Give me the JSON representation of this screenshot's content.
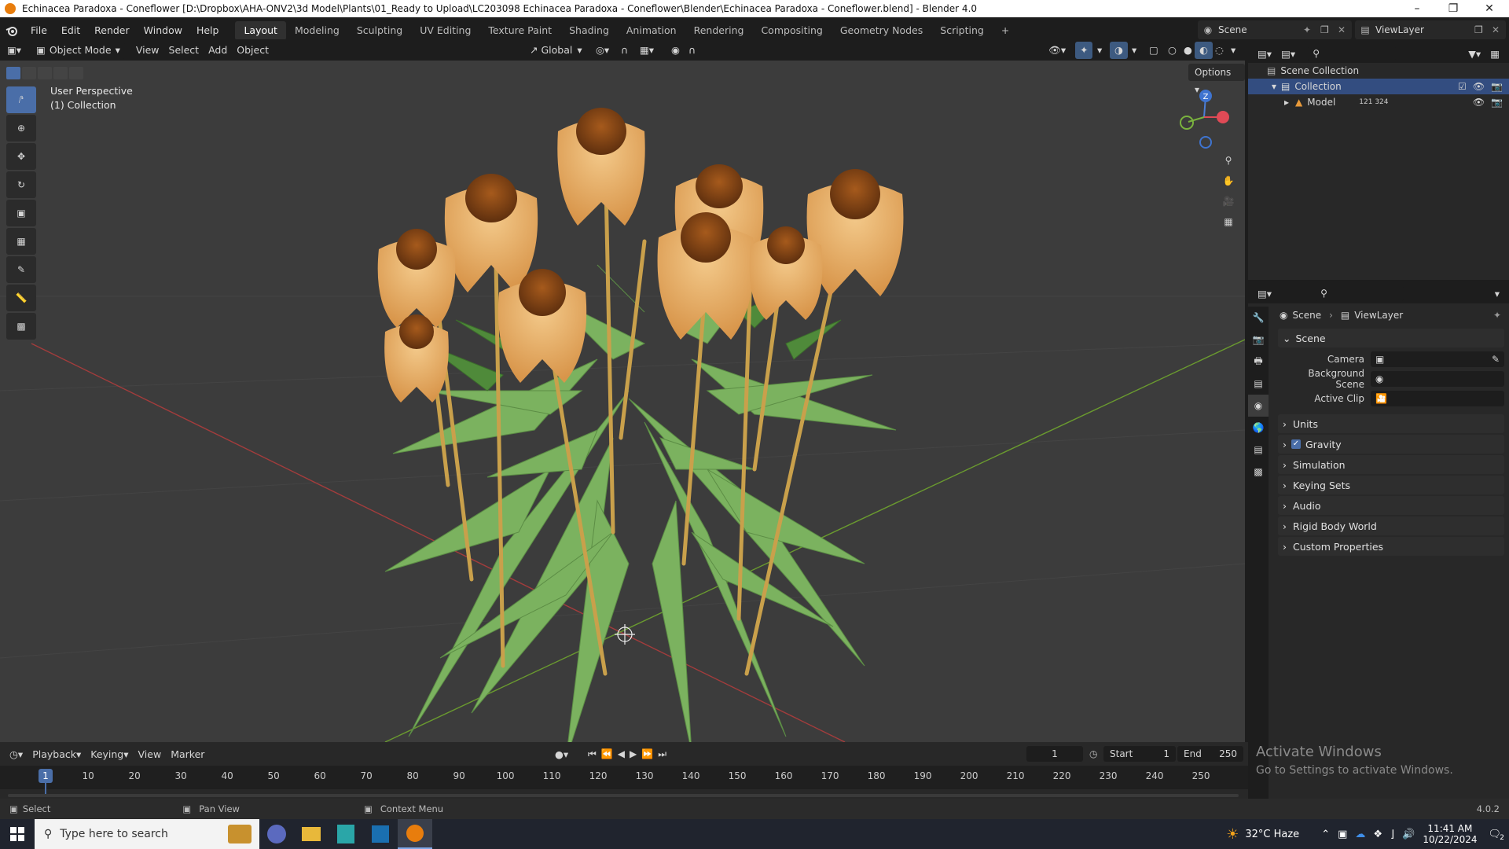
{
  "window": {
    "title": "Echinacea Paradoxa - Coneflower [D:\\Dropbox\\AHA-ONV2\\3d Model\\Plants\\01_Ready to Upload\\LC203098 Echinacea Paradoxa - Coneflower\\Blender\\Echinacea Paradoxa - Coneflower.blend] - Blender 4.0"
  },
  "menu": {
    "items": [
      "File",
      "Edit",
      "Render",
      "Window",
      "Help"
    ]
  },
  "workspaces": {
    "tabs": [
      "Layout",
      "Modeling",
      "Sculpting",
      "UV Editing",
      "Texture Paint",
      "Shading",
      "Animation",
      "Rendering",
      "Compositing",
      "Geometry Nodes",
      "Scripting"
    ],
    "active": "Layout"
  },
  "topright": {
    "scene_label": "Scene",
    "viewlayer_label": "ViewLayer"
  },
  "viewport_header": {
    "mode": "Object Mode",
    "menus": [
      "View",
      "Select",
      "Add",
      "Object"
    ],
    "orientation": "Global",
    "options": "Options"
  },
  "viewport": {
    "perspective": "User Perspective",
    "collection": "(1) Collection",
    "gizmo_z": "Z"
  },
  "outliner": {
    "root": "Scene Collection",
    "collection": "Collection",
    "model": "Model",
    "model_count": "121 324"
  },
  "properties": {
    "breadcrumb_scene": "Scene",
    "breadcrumb_viewlayer": "ViewLayer",
    "section": "Scene",
    "fields": [
      {
        "label": "Camera"
      },
      {
        "label": "Background Scene"
      },
      {
        "label": "Active Clip"
      }
    ],
    "panels": [
      "Units",
      "Gravity",
      "Simulation",
      "Keying Sets",
      "Audio",
      "Rigid Body World",
      "Custom Properties"
    ],
    "gravity_checked": true
  },
  "timeline": {
    "menus": [
      "Playback",
      "Keying",
      "View",
      "Marker"
    ],
    "current_frame": "1",
    "start_label": "Start",
    "start": "1",
    "end_label": "End",
    "end": "250",
    "ticks": [
      "10",
      "20",
      "30",
      "40",
      "50",
      "60",
      "70",
      "80",
      "90",
      "100",
      "110",
      "120",
      "130",
      "140",
      "150",
      "160",
      "170",
      "180",
      "190",
      "200",
      "210",
      "220",
      "230",
      "240",
      "250"
    ],
    "playhead": "1"
  },
  "watermark": {
    "line1": "Activate Windows",
    "line2": "Go to Settings to activate Windows."
  },
  "statusbar": {
    "select": "Select",
    "pan": "Pan View",
    "context": "Context Menu",
    "version": "4.0.2"
  },
  "taskbar": {
    "search_placeholder": "Type here to search",
    "weather": "32°C  Haze",
    "time": "11:41 AM",
    "date": "10/22/2024",
    "notifications": "2"
  },
  "colors": {
    "accent": "#4a6ea8",
    "petal": "#e6b06a",
    "leaf": "#6fae55",
    "stem": "#c8a04a"
  }
}
